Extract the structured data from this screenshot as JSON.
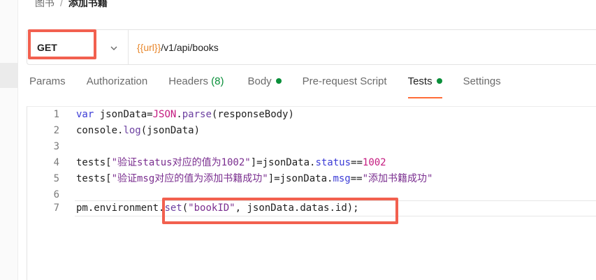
{
  "breadcrumb": {
    "parent": "图书",
    "separator": "/",
    "current": "添加书籍"
  },
  "request": {
    "method": "GET",
    "url_variable": "{{url}}",
    "url_path": "/v1/api/books"
  },
  "tabs": [
    {
      "label": "Params"
    },
    {
      "label": "Authorization"
    },
    {
      "label": "Headers",
      "count": "(8)"
    },
    {
      "label": "Body",
      "has_content": true
    },
    {
      "label": "Pre-request Script"
    },
    {
      "label": "Tests",
      "has_content": true,
      "active": true
    },
    {
      "label": "Settings"
    }
  ],
  "editor": {
    "lines": [
      {
        "number": "1",
        "tokens": [
          [
            "kw",
            "var"
          ],
          [
            "plain",
            " jsonData="
          ],
          [
            "obj",
            "JSON"
          ],
          [
            "plain",
            "."
          ],
          [
            "fn",
            "parse"
          ],
          [
            "plain",
            "(responseBody)"
          ]
        ]
      },
      {
        "number": "2",
        "tokens": [
          [
            "plain",
            "console."
          ],
          [
            "fn",
            "log"
          ],
          [
            "plain",
            "(jsonData)"
          ]
        ]
      },
      {
        "number": "3",
        "tokens": []
      },
      {
        "number": "4",
        "tokens": [
          [
            "plain",
            "tests["
          ],
          [
            "str",
            "\"验证status对应的值为1002\""
          ],
          [
            "plain",
            "]=jsonData."
          ],
          [
            "prop",
            "status"
          ],
          [
            "plain",
            "=="
          ],
          [
            "num",
            "1002"
          ]
        ]
      },
      {
        "number": "5",
        "tokens": [
          [
            "plain",
            "tests["
          ],
          [
            "str",
            "\"验证msg对应的值为添加书籍成功\""
          ],
          [
            "plain",
            "]=jsonData."
          ],
          [
            "prop",
            "msg"
          ],
          [
            "plain",
            "=="
          ],
          [
            "str",
            "\"添加书籍成功\""
          ]
        ]
      },
      {
        "number": "6",
        "tokens": []
      },
      {
        "number": "7",
        "tokens": [
          [
            "plain",
            "pm.environment."
          ],
          [
            "fn",
            "set"
          ],
          [
            "plain",
            "("
          ],
          [
            "str",
            "\"bookID\""
          ],
          [
            "plain",
            ", jsonData.datas.id);"
          ]
        ],
        "current": true
      }
    ]
  },
  "colors": {
    "accent": "#ff6c37",
    "success": "#0a8f3a",
    "url_variable": "#e8862a",
    "annotation": "#f2604f"
  }
}
